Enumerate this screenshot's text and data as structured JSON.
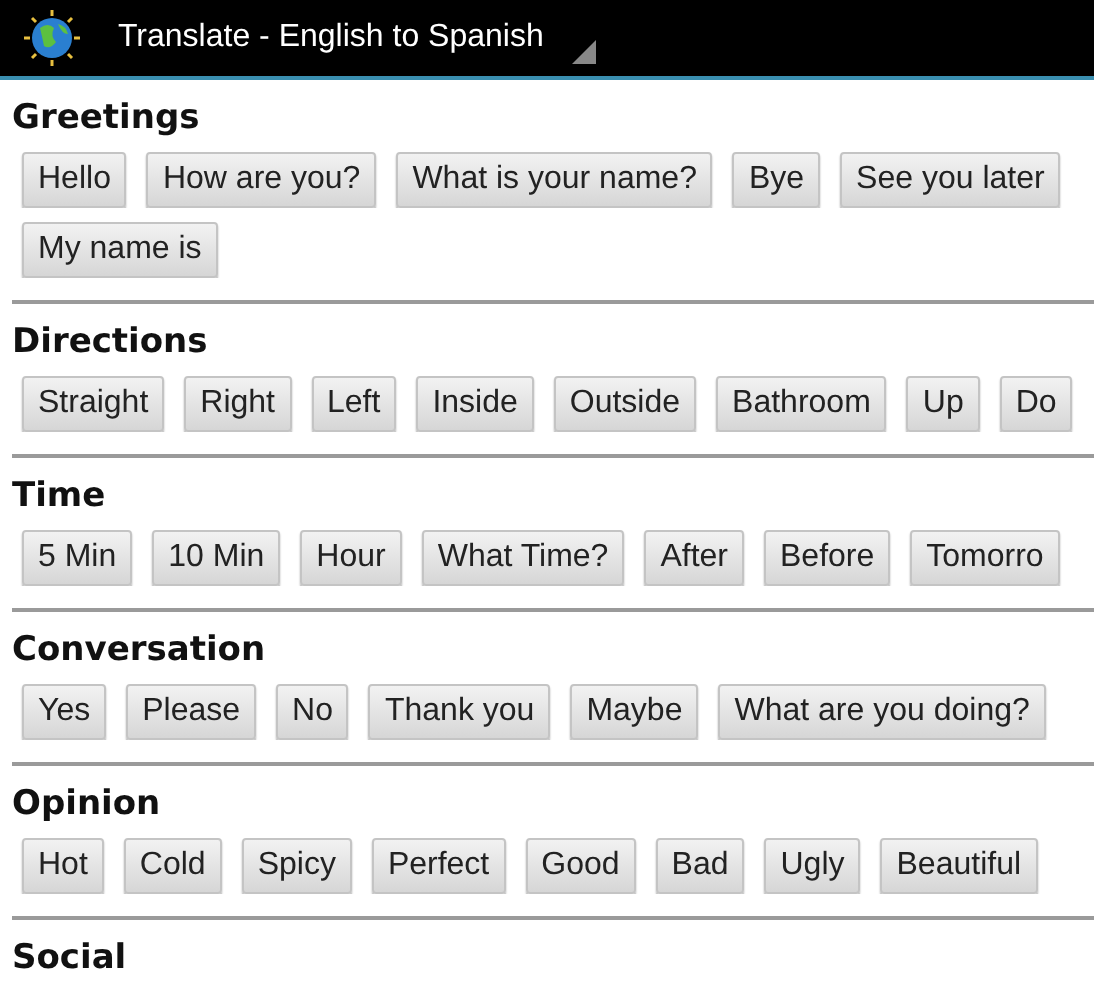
{
  "title_bar": {
    "title": "Translate - English to Spanish"
  },
  "sections": [
    {
      "heading": "Greetings",
      "rows": [
        [
          "Hello",
          "How are you?",
          "What is your name?",
          "Bye",
          "See you later"
        ],
        [
          "My name is"
        ]
      ]
    },
    {
      "heading": "Directions",
      "rows": [
        [
          "Straight",
          "Right",
          "Left",
          "Inside",
          "Outside",
          "Bathroom",
          "Up",
          "Do"
        ]
      ]
    },
    {
      "heading": "Time",
      "rows": [
        [
          "5 Min",
          "10 Min",
          "Hour",
          "What Time?",
          "After",
          "Before",
          "Tomorro"
        ]
      ]
    },
    {
      "heading": "Conversation",
      "rows": [
        [
          "Yes",
          "Please",
          "No",
          "Thank you",
          "Maybe",
          "What are you doing?"
        ]
      ]
    },
    {
      "heading": "Opinion",
      "rows": [
        [
          "Hot",
          "Cold",
          "Spicy",
          "Perfect",
          "Good",
          "Bad",
          "Ugly",
          "Beautiful"
        ]
      ]
    },
    {
      "heading": "Social"
    }
  ]
}
